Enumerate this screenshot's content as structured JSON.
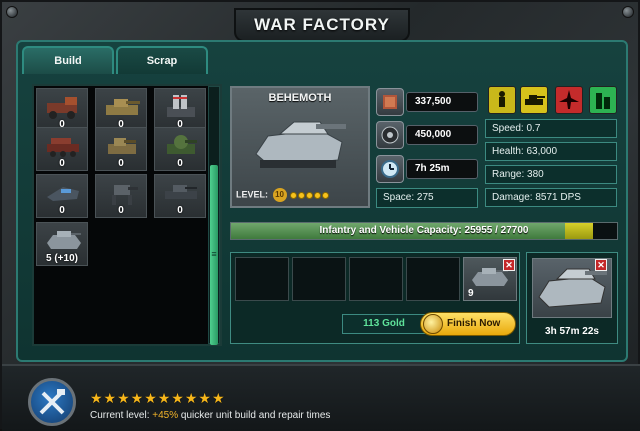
{
  "window": {
    "title": "WAR FACTORY"
  },
  "tabs": [
    {
      "label": "Build"
    },
    {
      "label": "Scrap"
    }
  ],
  "units": [
    {
      "icon": "artillery-truck-icon",
      "count": "0"
    },
    {
      "icon": "desert-tank-icon",
      "count": "0"
    },
    {
      "icon": "missile-launcher-icon",
      "count": "0"
    },
    {
      "icon": "rocket-truck-icon",
      "count": "0"
    },
    {
      "icon": "light-tank-icon",
      "count": "0"
    },
    {
      "icon": "green-tank-icon",
      "count": "0"
    },
    {
      "icon": "gunship-icon",
      "count": "0"
    },
    {
      "icon": "walker-icon",
      "count": "0"
    },
    {
      "icon": "hover-tank-icon",
      "count": "0"
    },
    {
      "icon": "behemoth-icon",
      "count": "5 (+10)"
    }
  ],
  "selected_unit": {
    "name": "BEHEMOTH",
    "level_label": "LEVEL:",
    "level": "10",
    "level_dots": 5,
    "cost_metal": "337,500",
    "cost_oil": "450,000",
    "build_time": "7h 25m",
    "space": "Space: 275",
    "speed": "Speed: 0.7",
    "health": "Health: 63,000",
    "range": "Range: 380",
    "damage": "Damage: 8571 DPS"
  },
  "type_filters": [
    {
      "name": "infantry",
      "color": "#c9b81a"
    },
    {
      "name": "vehicle",
      "color": "#d7c21b"
    },
    {
      "name": "air",
      "color": "#c42b2b"
    },
    {
      "name": "building",
      "color": "#2db352"
    }
  ],
  "capacity": {
    "label": "Infantry and Vehicle Capacity: 25955 / 27700",
    "used": 25955,
    "max": 27700
  },
  "queue": {
    "next_count": "9",
    "gold_cost": "113 Gold",
    "finish_label": "Finish Now",
    "timer": "3h 57m 22s"
  },
  "footer": {
    "stars": "★★★★★★★★★★",
    "label": "Current level:",
    "bonus": "+45%",
    "suffix": "quicker unit build and repair times"
  }
}
